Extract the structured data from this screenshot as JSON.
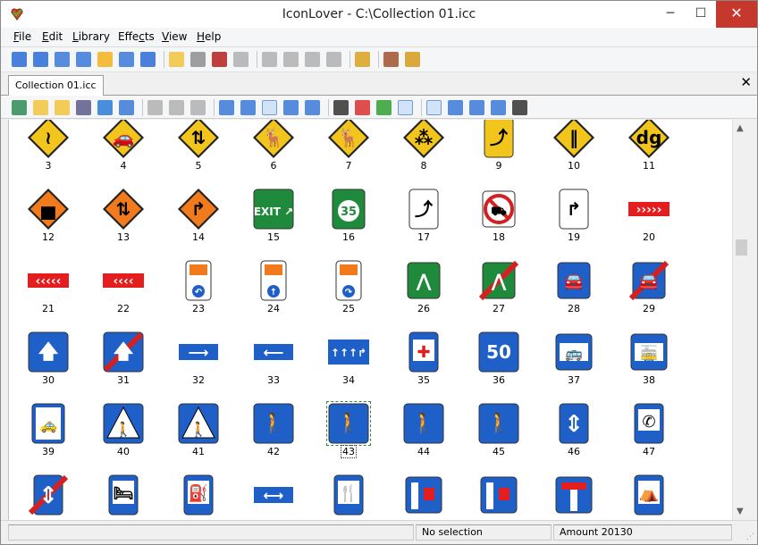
{
  "window": {
    "title": "IconLover - C:\\Collection 01.icc",
    "minimize_glyph": "─",
    "maximize_glyph": "☐",
    "close_glyph": "✕"
  },
  "menu": [
    {
      "name": "menu-file",
      "label": "File",
      "accel": "F"
    },
    {
      "name": "menu-edit",
      "label": "Edit",
      "accel": "E"
    },
    {
      "name": "menu-library",
      "label": "Library",
      "accel": "L"
    },
    {
      "name": "menu-effects",
      "label": "Effects",
      "accel": "c"
    },
    {
      "name": "menu-view",
      "label": "View",
      "accel": "V"
    },
    {
      "name": "menu-help",
      "label": "Help",
      "accel": "H"
    }
  ],
  "toolbar1": [
    {
      "icon": "new-document-icon",
      "color": "#2a6bd6"
    },
    {
      "icon": "new-icon-icon",
      "color": "#2a6bd6"
    },
    {
      "icon": "new-cursor-icon",
      "color": "#3a78d8"
    },
    {
      "icon": "new-animated-cursor-icon",
      "color": "#3a78d8"
    },
    {
      "icon": "new-image-icon",
      "color": "#f2b21b"
    },
    {
      "icon": "new-library-icon",
      "color": "#3a78d8"
    },
    {
      "icon": "extract-icon",
      "color": "#2a6bd6"
    },
    {
      "sep": true
    },
    {
      "icon": "open-folder-icon",
      "color": "#f1c33c"
    },
    {
      "icon": "save-icon",
      "color": "#8e8e8e"
    },
    {
      "icon": "save-all-icon",
      "color": "#b51d1d"
    },
    {
      "icon": "print-icon",
      "color": "#b0b0b0"
    },
    {
      "sep": true
    },
    {
      "icon": "cut-icon",
      "color": "#b0b0b0"
    },
    {
      "icon": "copy-icon",
      "color": "#b0b0b0"
    },
    {
      "icon": "paste-icon",
      "color": "#b0b0b0"
    },
    {
      "icon": "delete-icon",
      "color": "#b0b0b0"
    },
    {
      "sep": true
    },
    {
      "icon": "properties-icon",
      "color": "#d9a21f"
    },
    {
      "sep": true
    },
    {
      "icon": "wizard-icon",
      "color": "#a0522d"
    },
    {
      "icon": "help-book-icon",
      "color": "#d59a1a"
    }
  ],
  "tab": {
    "label": "Collection 01.icc",
    "close_glyph": "✕"
  },
  "toolbar2": [
    {
      "icon": "add-image-icon",
      "color": "#2e8b57"
    },
    {
      "icon": "add-folder-icon",
      "color": "#f1c33c"
    },
    {
      "icon": "add-from-files-icon",
      "color": "#f1c33c"
    },
    {
      "icon": "import-icon",
      "color": "#5a5a8a"
    },
    {
      "icon": "web-icon",
      "color": "#2a7bd6"
    },
    {
      "icon": "export-icon",
      "color": "#3a78d8"
    },
    {
      "sep": true
    },
    {
      "icon": "format-icon",
      "color": "#b0b0b0"
    },
    {
      "icon": "edit-pencil-icon",
      "color": "#b0b0b0"
    },
    {
      "icon": "grid-icon",
      "color": "#b0b0b0"
    },
    {
      "sep": true
    },
    {
      "icon": "small-icons-view-icon",
      "color": "#3a78d8"
    },
    {
      "icon": "medium-icons-view-icon",
      "color": "#3a78d8"
    },
    {
      "icon": "large-icons-view-icon",
      "color": "#3a78d8",
      "pressed": true
    },
    {
      "icon": "list-view-icon",
      "color": "#3a78d8"
    },
    {
      "icon": "details-view-icon",
      "color": "#3a78d8"
    },
    {
      "sep": true
    },
    {
      "icon": "monochrome-icon",
      "color": "#333333"
    },
    {
      "icon": "16-colors-icon",
      "color": "#d93030"
    },
    {
      "icon": "256-colors-icon",
      "color": "#30a030"
    },
    {
      "icon": "true-color-icon",
      "color": "#d9a21f",
      "pressed": true
    },
    {
      "sep": true
    },
    {
      "icon": "show-labels-icon",
      "color": "#3a78d8",
      "pressed": true
    },
    {
      "icon": "fit-icon",
      "color": "#3a78d8"
    },
    {
      "icon": "zoom-icon",
      "color": "#3a78d8"
    },
    {
      "icon": "thumbnail-size-icon",
      "color": "#3a78d8"
    },
    {
      "icon": "dropdown-arrow-icon",
      "color": "#333333"
    }
  ],
  "icons": [
    {
      "num": "3",
      "kind": "diamond-yellow",
      "glyph": "≀"
    },
    {
      "num": "4",
      "kind": "diamond-yellow",
      "glyph": "🚗"
    },
    {
      "num": "5",
      "kind": "diamond-yellow",
      "glyph": "⇅"
    },
    {
      "num": "6",
      "kind": "diamond-yellow",
      "glyph": "🦌"
    },
    {
      "num": "7",
      "kind": "diamond-yellow",
      "glyph": "🦌"
    },
    {
      "num": "8",
      "kind": "diamond-yellow",
      "glyph": "⁂"
    },
    {
      "num": "9",
      "kind": "rect-yellow",
      "glyph": "⤴"
    },
    {
      "num": "10",
      "kind": "diamond-yellow",
      "glyph": "‖"
    },
    {
      "num": "11",
      "kind": "diamond-yellow",
      "glyph": "dg"
    },
    {
      "num": "12",
      "kind": "diamond-orange",
      "glyph": "▅"
    },
    {
      "num": "13",
      "kind": "diamond-orange",
      "glyph": "⇅"
    },
    {
      "num": "14",
      "kind": "diamond-orange",
      "glyph": "↱"
    },
    {
      "num": "15",
      "kind": "exit",
      "glyph": "EXIT ↗"
    },
    {
      "num": "16",
      "kind": "shield",
      "glyph": "35"
    },
    {
      "num": "17",
      "kind": "rect-white",
      "glyph": "⤴"
    },
    {
      "num": "18",
      "kind": "no-truck",
      "glyph": "⛟"
    },
    {
      "num": "19",
      "kind": "rect-white",
      "glyph": "↱"
    },
    {
      "num": "20",
      "kind": "chevron-right",
      "glyph": "›››››"
    },
    {
      "num": "21",
      "kind": "chevron-left",
      "glyph": "‹‹‹‹‹"
    },
    {
      "num": "22",
      "kind": "chevron-left",
      "glyph": "‹‹‹‹"
    },
    {
      "num": "23",
      "kind": "hazmat",
      "glyph": "↶"
    },
    {
      "num": "24",
      "kind": "hazmat",
      "glyph": "↑"
    },
    {
      "num": "25",
      "kind": "hazmat",
      "glyph": "↷"
    },
    {
      "num": "26",
      "kind": "green-road",
      "glyph": "⋀"
    },
    {
      "num": "27",
      "kind": "green-road-end",
      "glyph": "⋀"
    },
    {
      "num": "28",
      "kind": "blue-car",
      "glyph": "🚘"
    },
    {
      "num": "29",
      "kind": "blue-car-end",
      "glyph": "🚘"
    },
    {
      "num": "30",
      "kind": "blue-square",
      "glyph": "🡅"
    },
    {
      "num": "31",
      "kind": "blue-square-end",
      "glyph": "🡅"
    },
    {
      "num": "32",
      "kind": "blue-bar",
      "glyph": "⟶"
    },
    {
      "num": "33",
      "kind": "blue-bar",
      "glyph": "⟵"
    },
    {
      "num": "34",
      "kind": "blue-lanes",
      "glyph": "↑↑↑↱"
    },
    {
      "num": "35",
      "kind": "blue-hospital",
      "glyph": "✚"
    },
    {
      "num": "36",
      "kind": "blue-speed",
      "glyph": "50"
    },
    {
      "num": "37",
      "kind": "blue-bus",
      "glyph": "🚌"
    },
    {
      "num": "38",
      "kind": "blue-tram",
      "glyph": "🚋"
    },
    {
      "num": "39",
      "kind": "taxi",
      "glyph": "🚕"
    },
    {
      "num": "40",
      "kind": "crosswalk",
      "glyph": "🚶"
    },
    {
      "num": "41",
      "kind": "crosswalk",
      "glyph": "🚶"
    },
    {
      "num": "42",
      "kind": "blue-square",
      "glyph": "🚶"
    },
    {
      "num": "43",
      "kind": "blue-square",
      "glyph": "🚶",
      "selected": true
    },
    {
      "num": "44",
      "kind": "blue-square",
      "glyph": "🚶"
    },
    {
      "num": "45",
      "kind": "blue-square",
      "glyph": "🚶"
    },
    {
      "num": "46",
      "kind": "blue-tall",
      "glyph": "⇕"
    },
    {
      "num": "47",
      "kind": "blue-phone",
      "glyph": "✆"
    },
    {
      "num": "",
      "kind": "blue-tall-end",
      "glyph": "⇕"
    },
    {
      "num": "",
      "kind": "blue-hotel",
      "glyph": "🛏"
    },
    {
      "num": "",
      "kind": "blue-fuel",
      "glyph": "⛽"
    },
    {
      "num": "",
      "kind": "blue-bar",
      "glyph": "⟷"
    },
    {
      "num": "",
      "kind": "blue-food",
      "glyph": "🍴"
    },
    {
      "num": "",
      "kind": "blue-deadend",
      "glyph": "H"
    },
    {
      "num": "",
      "kind": "blue-deadend",
      "glyph": "H"
    },
    {
      "num": "",
      "kind": "blue-tee",
      "glyph": "T"
    },
    {
      "num": "",
      "kind": "blue-camp",
      "glyph": "⛺"
    }
  ],
  "status": {
    "selection": "No selection",
    "amount": "Amount 20130",
    "grip": "⋰"
  },
  "scroll": {
    "up_glyph": "▲",
    "down_glyph": "▼"
  }
}
